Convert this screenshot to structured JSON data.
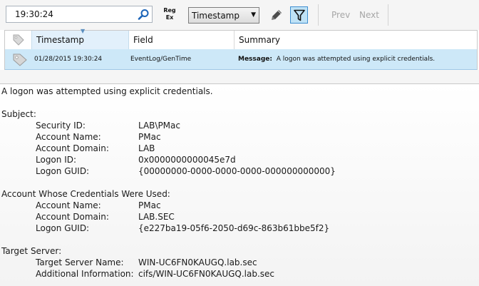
{
  "toolbar": {
    "search_value": "19:30:24",
    "regex_line1": "Reg",
    "regex_line2": "Ex",
    "field_selected": "Timestamp",
    "prev_label": "Prev",
    "next_label": "Next"
  },
  "grid": {
    "columns": [
      "Timestamp",
      "Field",
      "Summary"
    ],
    "rows": [
      {
        "timestamp": "01/28/2015 19:30:24",
        "field": "EventLog/GenTime",
        "summary_label": "Message:",
        "summary_text": "A logon was attempted using explicit credentials."
      }
    ]
  },
  "detail": {
    "message": "A logon was attempted using explicit credentials.",
    "subject": {
      "heading": "Subject:",
      "items": [
        {
          "label": "Security ID:",
          "value": "LAB\\PMac"
        },
        {
          "label": "Account Name:",
          "value": "PMac"
        },
        {
          "label": "Account Domain:",
          "value": "LAB"
        },
        {
          "label": "Logon ID:",
          "value": "0x0000000000045e7d"
        },
        {
          "label": "Logon GUID:",
          "value": "{00000000-0000-0000-0000-000000000000}"
        }
      ]
    },
    "credentials": {
      "heading": "Account Whose Credentials Were Used:",
      "items": [
        {
          "label": "Account Name:",
          "value": "PMac"
        },
        {
          "label": "Account Domain:",
          "value": "LAB.SEC"
        },
        {
          "label": "Logon GUID:",
          "value": "{e227ba19-05f6-2050-d69c-863b61bbe5f2}"
        }
      ]
    },
    "target": {
      "heading": "Target Server:",
      "items": [
        {
          "label": "Target Server Name:",
          "value": "WIN-UC6FN0KAUGQ.lab.sec"
        },
        {
          "label": "Additional Information:",
          "value": "cifs/WIN-UC6FN0KAUGQ.lab.sec"
        }
      ]
    }
  },
  "icons": {
    "search": "search-icon",
    "edit": "pencil-icon",
    "filter": "filter-funnel-icon",
    "tag": "tag-icon"
  },
  "colors": {
    "accent": "#3e8ed0",
    "selected_row": "#cde8f8",
    "filter_active": "#bfe2f6"
  }
}
